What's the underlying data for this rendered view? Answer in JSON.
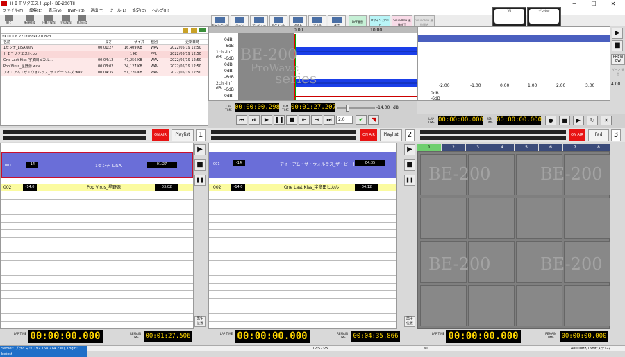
{
  "window": {
    "title": "ＨＩＴリクエスト.ppl - BE-200TII",
    "minimize": "─",
    "maximize": "☐",
    "close": "✕"
  },
  "menu": [
    "ファイル(F)",
    "編集(E)",
    "表示(V)",
    "BWF-J(B)",
    "送出(T)",
    "ツール(L)",
    "設定(O)",
    "ヘルプ(H)"
  ],
  "file_toolbar": [
    "開く",
    "新規作成",
    "上書き保存",
    "全体保存",
    "Playlist"
  ],
  "toolbar": [
    "ギャレクション",
    "ジーン",
    "プレビュー",
    "セグメント",
    "Pad & Playlist",
    "マルチ",
    "送信",
    "DAF書替",
    "Dマイン /アウト",
    "SoundBox 連携終了",
    "SoundBox 連携開始"
  ],
  "meters": {
    "left": "VU",
    "right": "デジタル"
  },
  "file_panel": {
    "path": "¥¥10.1.6.221¥sbox¥210873",
    "columns": {
      "name": "名前",
      "length": "長さ",
      "size": "サイズ",
      "type": "種別",
      "updated": "更新日時"
    },
    "rows": [
      {
        "name": "1センチ_LiSA.wav",
        "length": "00:01:27",
        "size": "16,409 KB",
        "type": "WAV",
        "updated": "2022/05/19 12:50"
      },
      {
        "name": "ＨＩＴリクエスト.ppl",
        "length": "",
        "size": "1 KB",
        "type": "PPL",
        "updated": "2022/05/19 12:50"
      },
      {
        "name": "One Last Kiss_宇多田ヒカル...",
        "length": "00:04:12",
        "size": "47,256 KB",
        "type": "WAV",
        "updated": "2022/05/19 12:50"
      },
      {
        "name": "Pop Virus_星野源.wav",
        "length": "00:03:02",
        "size": "34,127 KB",
        "type": "WAV",
        "updated": "2022/05/19 12:50"
      },
      {
        "name": "アイ・アム・ザ・ウォルラス_ザ・ビートルズ.wav",
        "length": "00:04:35",
        "size": "51,726 KB",
        "type": "WAV",
        "updated": "2022/05/19 12:50"
      }
    ]
  },
  "waveform": {
    "t0": "0.00",
    "t10": "10.00",
    "lane_labels": [
      "0dB",
      "-6dB",
      "1ch -inf dB",
      "-6dB",
      "0dB",
      "0dB",
      "-6dB",
      "2ch -inf dB",
      "-6dB",
      "0dB"
    ],
    "watermark_top": "BE-200",
    "watermark_mid": "ProWav.c",
    "watermark_bot": "series"
  },
  "right_panel": {
    "scale": [
      "-2.00",
      "-1.00",
      "0.00",
      "1.00",
      "2.00",
      "3.00",
      "4.00"
    ],
    "db": [
      "0dB",
      "-6dB",
      "0dB",
      "-6dB",
      "0dB"
    ],
    "preview": "PREVI EW",
    "side_label": "ゲーン 送出"
  },
  "transport": {
    "lap_label": "LAP TIME",
    "rem_label": "REM TIME",
    "lap": "00:00:00.298",
    "rem": "00:01:27.207",
    "gain": "-14.00",
    "gain_unit": "dB",
    "speed": "2.0",
    "lap2": "00:00:00.000",
    "rem2": "00:00:00.000"
  },
  "decks": [
    {
      "onair": "ON AIR",
      "mode": "Playlist",
      "num": "1",
      "cue": {
        "idx": "001",
        "gain": "-14",
        "title": "1センチ_LiSA",
        "time": "01:27"
      },
      "next": {
        "idx": "002",
        "gain": "-14.0",
        "title": "Pop Virus_星野源",
        "time": "03:02"
      },
      "lap": "00:00:00.000",
      "remain": "00:01:27.506"
    },
    {
      "onair": "ON AIR",
      "mode": "Playlist",
      "num": "2",
      "cue": {
        "idx": "001",
        "gain": "-14",
        "title": "アイ・アム・ザ・ウォルラス_ザ・ビートルズ",
        "time": "04:35"
      },
      "next": {
        "idx": "002",
        "gain": "-14.0",
        "title": "One Last Kiss_宇多田ヒカル",
        "time": "04:12"
      },
      "lap": "00:00:00.000",
      "remain": "00:04:35.866"
    },
    {
      "onair": "ON AIR",
      "mode": "Pad",
      "num": "3",
      "lap": "00:00:00.000",
      "remain": "00:00:00.000"
    }
  ],
  "pad_tabs": [
    "1",
    "2",
    "3",
    "4",
    "5",
    "6",
    "7",
    "8"
  ],
  "labels": {
    "lap": "LAP TIME",
    "remain": "REMAIN TIME",
    "replay": "再生 位置",
    "play": "▶",
    "stop": "■",
    "pause": "❚❚"
  },
  "status": {
    "server": "Server: プライマリ(192.168.214.230), Login: betest",
    "time": "12:52:25",
    "mc": "MC",
    "fmt": "48000Hz/16bit/ステレオ"
  },
  "colors": {
    "onair": "#e81313",
    "cue": "#6a6ed8",
    "next": "#fbfba0",
    "lcd_text": "#ffd600"
  }
}
